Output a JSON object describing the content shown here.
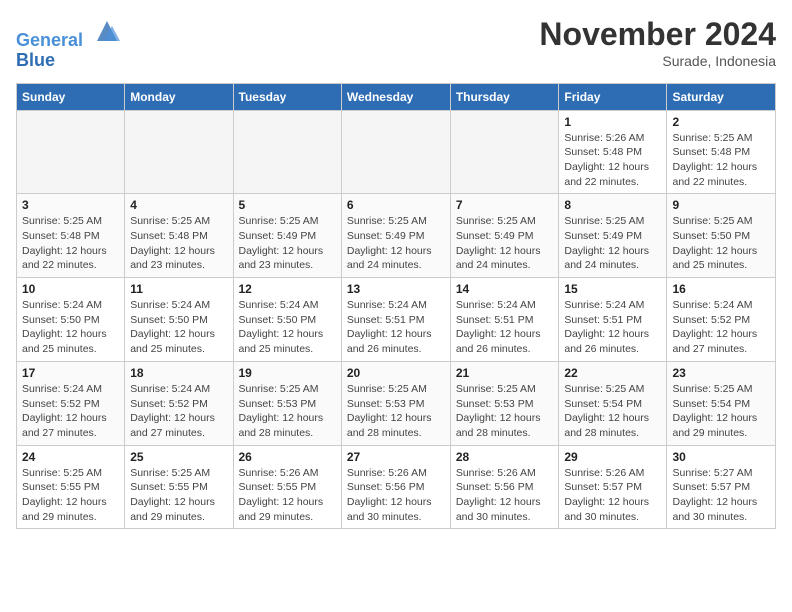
{
  "logo": {
    "line1": "General",
    "line2": "Blue"
  },
  "header": {
    "month": "November 2024",
    "location": "Surade, Indonesia"
  },
  "weekdays": [
    "Sunday",
    "Monday",
    "Tuesday",
    "Wednesday",
    "Thursday",
    "Friday",
    "Saturday"
  ],
  "weeks": [
    [
      {
        "day": "",
        "info": ""
      },
      {
        "day": "",
        "info": ""
      },
      {
        "day": "",
        "info": ""
      },
      {
        "day": "",
        "info": ""
      },
      {
        "day": "",
        "info": ""
      },
      {
        "day": "1",
        "info": "Sunrise: 5:26 AM\nSunset: 5:48 PM\nDaylight: 12 hours and 22 minutes."
      },
      {
        "day": "2",
        "info": "Sunrise: 5:25 AM\nSunset: 5:48 PM\nDaylight: 12 hours and 22 minutes."
      }
    ],
    [
      {
        "day": "3",
        "info": "Sunrise: 5:25 AM\nSunset: 5:48 PM\nDaylight: 12 hours and 22 minutes."
      },
      {
        "day": "4",
        "info": "Sunrise: 5:25 AM\nSunset: 5:48 PM\nDaylight: 12 hours and 23 minutes."
      },
      {
        "day": "5",
        "info": "Sunrise: 5:25 AM\nSunset: 5:49 PM\nDaylight: 12 hours and 23 minutes."
      },
      {
        "day": "6",
        "info": "Sunrise: 5:25 AM\nSunset: 5:49 PM\nDaylight: 12 hours and 24 minutes."
      },
      {
        "day": "7",
        "info": "Sunrise: 5:25 AM\nSunset: 5:49 PM\nDaylight: 12 hours and 24 minutes."
      },
      {
        "day": "8",
        "info": "Sunrise: 5:25 AM\nSunset: 5:49 PM\nDaylight: 12 hours and 24 minutes."
      },
      {
        "day": "9",
        "info": "Sunrise: 5:25 AM\nSunset: 5:50 PM\nDaylight: 12 hours and 25 minutes."
      }
    ],
    [
      {
        "day": "10",
        "info": "Sunrise: 5:24 AM\nSunset: 5:50 PM\nDaylight: 12 hours and 25 minutes."
      },
      {
        "day": "11",
        "info": "Sunrise: 5:24 AM\nSunset: 5:50 PM\nDaylight: 12 hours and 25 minutes."
      },
      {
        "day": "12",
        "info": "Sunrise: 5:24 AM\nSunset: 5:50 PM\nDaylight: 12 hours and 25 minutes."
      },
      {
        "day": "13",
        "info": "Sunrise: 5:24 AM\nSunset: 5:51 PM\nDaylight: 12 hours and 26 minutes."
      },
      {
        "day": "14",
        "info": "Sunrise: 5:24 AM\nSunset: 5:51 PM\nDaylight: 12 hours and 26 minutes."
      },
      {
        "day": "15",
        "info": "Sunrise: 5:24 AM\nSunset: 5:51 PM\nDaylight: 12 hours and 26 minutes."
      },
      {
        "day": "16",
        "info": "Sunrise: 5:24 AM\nSunset: 5:52 PM\nDaylight: 12 hours and 27 minutes."
      }
    ],
    [
      {
        "day": "17",
        "info": "Sunrise: 5:24 AM\nSunset: 5:52 PM\nDaylight: 12 hours and 27 minutes."
      },
      {
        "day": "18",
        "info": "Sunrise: 5:24 AM\nSunset: 5:52 PM\nDaylight: 12 hours and 27 minutes."
      },
      {
        "day": "19",
        "info": "Sunrise: 5:25 AM\nSunset: 5:53 PM\nDaylight: 12 hours and 28 minutes."
      },
      {
        "day": "20",
        "info": "Sunrise: 5:25 AM\nSunset: 5:53 PM\nDaylight: 12 hours and 28 minutes."
      },
      {
        "day": "21",
        "info": "Sunrise: 5:25 AM\nSunset: 5:53 PM\nDaylight: 12 hours and 28 minutes."
      },
      {
        "day": "22",
        "info": "Sunrise: 5:25 AM\nSunset: 5:54 PM\nDaylight: 12 hours and 28 minutes."
      },
      {
        "day": "23",
        "info": "Sunrise: 5:25 AM\nSunset: 5:54 PM\nDaylight: 12 hours and 29 minutes."
      }
    ],
    [
      {
        "day": "24",
        "info": "Sunrise: 5:25 AM\nSunset: 5:55 PM\nDaylight: 12 hours and 29 minutes."
      },
      {
        "day": "25",
        "info": "Sunrise: 5:25 AM\nSunset: 5:55 PM\nDaylight: 12 hours and 29 minutes."
      },
      {
        "day": "26",
        "info": "Sunrise: 5:26 AM\nSunset: 5:55 PM\nDaylight: 12 hours and 29 minutes."
      },
      {
        "day": "27",
        "info": "Sunrise: 5:26 AM\nSunset: 5:56 PM\nDaylight: 12 hours and 30 minutes."
      },
      {
        "day": "28",
        "info": "Sunrise: 5:26 AM\nSunset: 5:56 PM\nDaylight: 12 hours and 30 minutes."
      },
      {
        "day": "29",
        "info": "Sunrise: 5:26 AM\nSunset: 5:57 PM\nDaylight: 12 hours and 30 minutes."
      },
      {
        "day": "30",
        "info": "Sunrise: 5:27 AM\nSunset: 5:57 PM\nDaylight: 12 hours and 30 minutes."
      }
    ]
  ]
}
